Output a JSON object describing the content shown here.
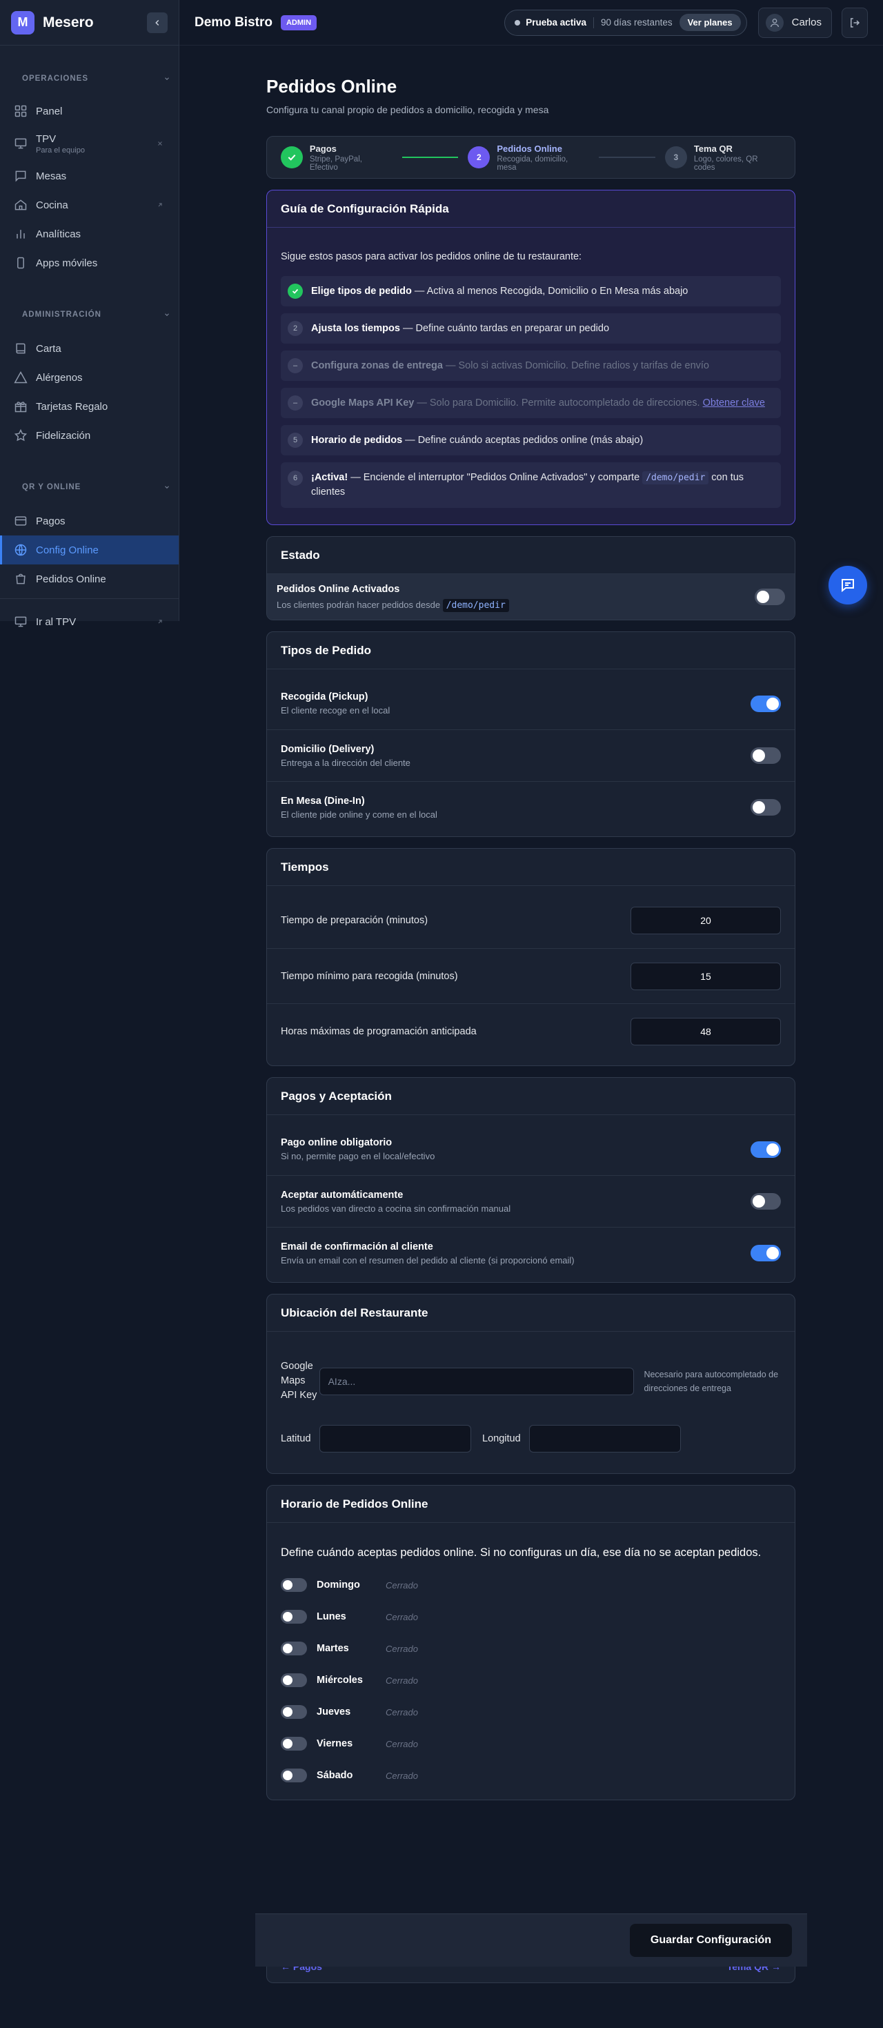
{
  "app": {
    "name": "Mesero",
    "logo_letter": "M"
  },
  "sidebar": {
    "sections": [
      {
        "title": "OPERACIONES"
      },
      {
        "title": "ADMINISTRACIÓN"
      },
      {
        "title": "QR Y ONLINE"
      }
    ],
    "items": [
      {
        "label": "Panel",
        "icon": "grid-icon"
      },
      {
        "label": "TPV",
        "sub": "Para el equipo",
        "icon": "monitor-icon"
      },
      {
        "label": "Mesas",
        "icon": "chat-square-icon"
      },
      {
        "label": "Cocina",
        "icon": "home-icon"
      },
      {
        "label": "Analíticas",
        "icon": "bar-chart-icon"
      },
      {
        "label": "Apps móviles",
        "icon": "phone-icon"
      },
      {
        "label": "Carta",
        "icon": "book-icon"
      },
      {
        "label": "Alérgenos",
        "icon": "warning-triangle-icon"
      },
      {
        "label": "Tarjetas Regalo",
        "icon": "gift-icon"
      },
      {
        "label": "Fidelización",
        "icon": "star-icon"
      },
      {
        "label": "Pagos",
        "icon": "credit-card-icon"
      },
      {
        "label": "Config Online",
        "icon": "globe-icon",
        "active": true
      },
      {
        "label": "Pedidos Online",
        "icon": "shopping-bag-icon"
      },
      {
        "label": "Ir al TPV",
        "icon": "monitor-icon"
      }
    ]
  },
  "topbar": {
    "restaurant": "Demo Bistro",
    "role_badge": "ADMIN",
    "trial_label": "Prueba activa",
    "trial_days": "90 días restantes",
    "plans_button": "Ver planes",
    "user_name": "Carlos"
  },
  "page": {
    "title": "Pedidos Online",
    "subtitle": "Configura tu canal propio de pedidos a domicilio, recogida y mesa"
  },
  "stepper": [
    {
      "title": "Pagos",
      "sub": "Stripe, PayPal, Efectivo",
      "state": "done"
    },
    {
      "num": "2",
      "title": "Pedidos Online",
      "sub": "Recogida, domicilio, mesa",
      "state": "current"
    },
    {
      "num": "3",
      "title": "Tema QR",
      "sub": "Logo, colores, QR codes",
      "state": "next"
    }
  ],
  "guide": {
    "title": "Guía de Configuración Rápida",
    "intro": "Sigue estos pasos para activar los pedidos online de tu restaurante:",
    "steps": [
      {
        "bold": "Elige tipos de pedido",
        "text": " — Activa al menos Recogida, Domicilio o En Mesa más abajo"
      },
      {
        "num": "2",
        "bold": "Ajusta los tiempos",
        "text": " — Define cuánto tardas en preparar un pedido"
      },
      {
        "num": "–",
        "bold": "Configura zonas de entrega",
        "text": " — Solo si activas Domicilio. Define radios y tarifas de envío"
      },
      {
        "num": "–",
        "bold": "Google Maps API Key",
        "text": " — Solo para Domicilio. Permite autocompletado de direcciones. ",
        "link": "Obtener clave"
      },
      {
        "num": "5",
        "bold": "Horario de pedidos",
        "text": " — Define cuándo aceptas pedidos online (más abajo)"
      },
      {
        "num": "6",
        "bold": "¡Activa!",
        "text": " — Enciende el interruptor \"Pedidos Online Activados\" y comparte ",
        "code": "/demo/pedir",
        "text2": " con tus clientes"
      }
    ]
  },
  "estado": {
    "title": "Estado",
    "label": "Pedidos Online Activados",
    "desc": "Los clientes podrán hacer pedidos desde ",
    "code": "/demo/pedir",
    "enabled": false
  },
  "tipos": {
    "title": "Tipos de Pedido",
    "items": [
      {
        "label": "Recogida (Pickup)",
        "desc": "El cliente recoge en el local",
        "on": true
      },
      {
        "label": "Domicilio (Delivery)",
        "desc": "Entrega a la dirección del cliente",
        "on": false
      },
      {
        "label": "En Mesa (Dine-In)",
        "desc": "El cliente pide online y come en el local",
        "on": false
      }
    ]
  },
  "tiempos": {
    "title": "Tiempos",
    "items": [
      {
        "label": "Tiempo de preparación (minutos)",
        "value": "20"
      },
      {
        "label": "Tiempo mínimo para recogida (minutos)",
        "value": "15"
      },
      {
        "label": "Horas máximas de programación anticipada",
        "value": "48"
      }
    ]
  },
  "pagos": {
    "title": "Pagos y Aceptación",
    "items": [
      {
        "label": "Pago online obligatorio",
        "desc": "Si no, permite pago en el local/efectivo",
        "on": true
      },
      {
        "label": "Aceptar automáticamente",
        "desc": "Los pedidos van directo a cocina sin confirmación manual",
        "on": false
      },
      {
        "label": "Email de confirmación al cliente",
        "desc": "Envía un email con el resumen del pedido al cliente (si proporcionó email)",
        "on": true
      }
    ]
  },
  "ubicacion": {
    "title": "Ubicación del Restaurante",
    "api_label": "Google Maps API Key",
    "api_placeholder": "AIza...",
    "api_hint": "Necesario para autocompletado de direcciones de entrega",
    "lat_label": "Latitud",
    "lng_label": "Longitud"
  },
  "horario": {
    "title": "Horario de Pedidos Online",
    "intro": "Define cuándo aceptas pedidos online. Si no configuras un día, ese día no se aceptan pedidos.",
    "days": [
      {
        "name": "Domingo",
        "status": "Cerrado"
      },
      {
        "name": "Lunes",
        "status": "Cerrado"
      },
      {
        "name": "Martes",
        "status": "Cerrado"
      },
      {
        "name": "Miércoles",
        "status": "Cerrado"
      },
      {
        "name": "Jueves",
        "status": "Cerrado"
      },
      {
        "name": "Viernes",
        "status": "Cerrado"
      },
      {
        "name": "Sábado",
        "status": "Cerrado"
      }
    ]
  },
  "footer": {
    "save": "Guardar Configuración",
    "prev": "← Pagos",
    "next": "Tema QR →"
  },
  "colors": {
    "accent": "#6366f1",
    "toggle_on": "#3b82f6",
    "success": "#22c55e",
    "background": "#111827"
  }
}
